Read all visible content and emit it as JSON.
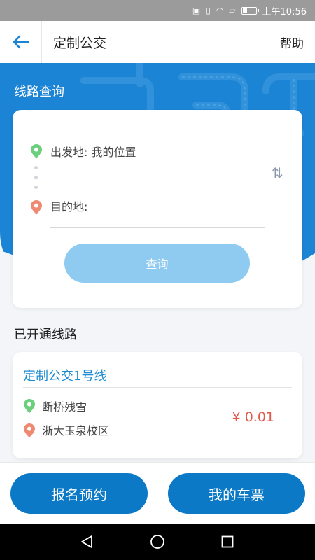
{
  "status_bar": {
    "time": "上午10:56",
    "icons": [
      "nfc-icon",
      "vibrate-icon",
      "wifi-icon",
      "sim-alert-icon",
      "battery-icon"
    ]
  },
  "header": {
    "title": "定制公交",
    "help": "帮助",
    "back_icon": "back-arrow-icon"
  },
  "search": {
    "section_title": "线路查询",
    "origin_label": "出发地: 我的位置",
    "destination_label": "目的地:",
    "swap_icon": "swap-icon",
    "query_button": "查询"
  },
  "routes": {
    "section_title": "已开通线路",
    "items": [
      {
        "name": "定制公交1号线",
        "start": "断桥残雪",
        "end": "浙大玉泉校区",
        "price": "¥ 0.01"
      }
    ]
  },
  "bottom": {
    "signup_button": "报名预约",
    "tickets_button": "我的车票"
  },
  "colors": {
    "primary": "#1c84d4",
    "button": "#0b79c6",
    "query_button": "#8fcbf0",
    "start_pin": "#6ccf7d",
    "end_pin": "#ef8a72",
    "price": "#e05a4c",
    "route_name": "#1d8bd1"
  }
}
